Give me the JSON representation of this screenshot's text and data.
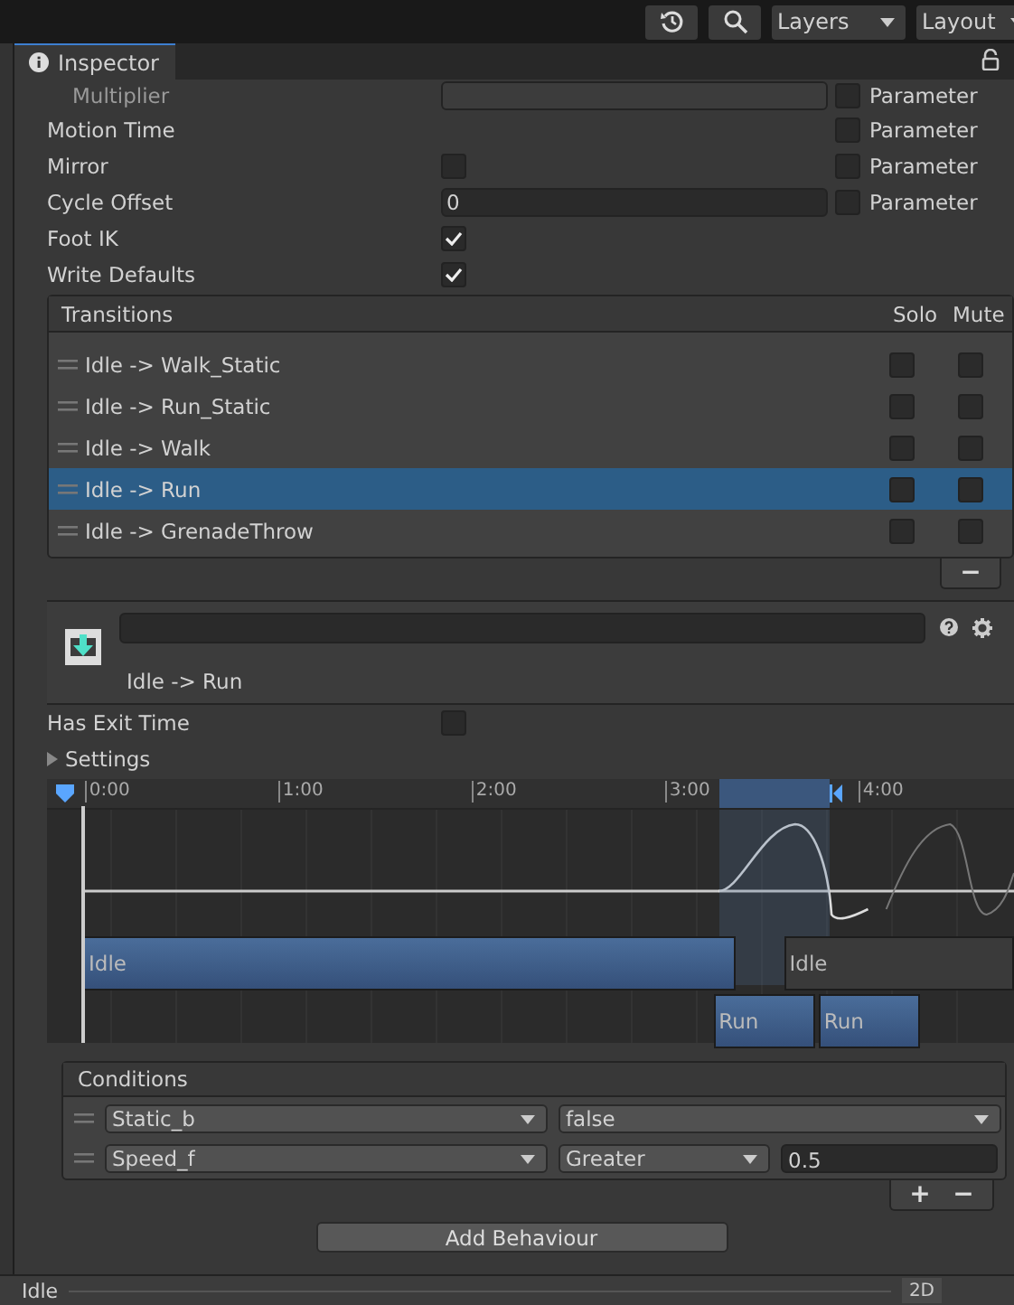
{
  "toolbar": {
    "layers": "Layers",
    "layout": "Layout"
  },
  "tab": {
    "label": "Inspector"
  },
  "properties": [
    {
      "label": "Multiplier",
      "kind": "dropdown",
      "parameter": false,
      "parameter_label": "Parameter"
    },
    {
      "label": "Motion Time",
      "kind": "none",
      "parameter": false,
      "parameter_label": "Parameter"
    },
    {
      "label": "Mirror",
      "kind": "checkbox",
      "checked": false,
      "parameter": false,
      "parameter_label": "Parameter"
    },
    {
      "label": "Cycle Offset",
      "kind": "field",
      "value": "0",
      "parameter": false,
      "parameter_label": "Parameter"
    },
    {
      "label": "Foot IK",
      "kind": "checkbox",
      "checked": true
    },
    {
      "label": "Write Defaults",
      "kind": "checkbox",
      "checked": true
    }
  ],
  "transitions": {
    "title": "Transitions",
    "solo_label": "Solo",
    "mute_label": "Mute",
    "rows": [
      {
        "name": "Idle -> Walk_Static",
        "selected": false,
        "solo": false,
        "mute": false
      },
      {
        "name": "Idle -> Run_Static",
        "selected": false,
        "solo": false,
        "mute": false
      },
      {
        "name": "Idle -> Walk",
        "selected": false,
        "solo": false,
        "mute": false
      },
      {
        "name": "Idle -> Run",
        "selected": true,
        "solo": false,
        "mute": false
      },
      {
        "name": "Idle -> GrenadeThrow",
        "selected": false,
        "solo": false,
        "mute": false
      }
    ],
    "remove": "−"
  },
  "transition": {
    "title": "Idle -> Run",
    "has_exit_time_label": "Has Exit Time",
    "has_exit_time": false,
    "settings": "Settings",
    "settings_expanded": false
  },
  "timeline": {
    "ticks": [
      "0:00",
      "1:00",
      "2:00",
      "3:00",
      "4:00"
    ],
    "clips": [
      {
        "label": "Idle",
        "active": true
      },
      {
        "label": "Idle",
        "active": false
      },
      {
        "label": "Run",
        "active": true
      },
      {
        "label": "Run",
        "active": true
      }
    ]
  },
  "conditions": {
    "title": "Conditions",
    "rows": [
      {
        "parameter": "Static_b",
        "mode": "false"
      },
      {
        "parameter": "Speed_f",
        "mode": "Greater",
        "value": "0.5"
      }
    ],
    "add": "+",
    "remove": "−"
  },
  "add_behaviour": "Add Behaviour",
  "status_bar": {
    "state": "Idle",
    "mode": "2D"
  }
}
